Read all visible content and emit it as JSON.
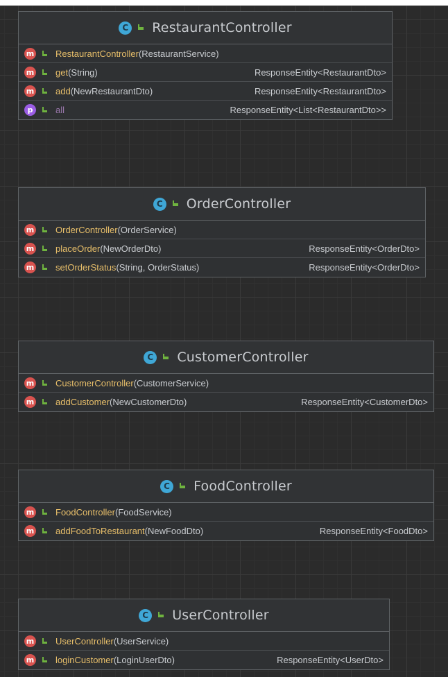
{
  "classes": [
    {
      "name": "RestaurantController",
      "icon": "class-icon",
      "members": [
        {
          "icon": "method-icon",
          "name": "RestaurantController",
          "params": "(RestaurantService)",
          "returns": ""
        },
        {
          "icon": "method-icon",
          "name": "get",
          "params": "(String)",
          "returns": "ResponseEntity<RestaurantDto>"
        },
        {
          "icon": "method-icon",
          "name": "add",
          "params": "(NewRestaurantDto)",
          "returns": "ResponseEntity<RestaurantDto>"
        },
        {
          "icon": "property-icon",
          "name": "all",
          "params": "",
          "returns": "ResponseEntity<List<RestaurantDto>>"
        }
      ]
    },
    {
      "name": "OrderController",
      "icon": "class-icon",
      "members": [
        {
          "icon": "method-icon",
          "name": "OrderController",
          "params": "(OrderService)",
          "returns": ""
        },
        {
          "icon": "method-icon",
          "name": "placeOrder",
          "params": "(NewOrderDto)",
          "returns": "ResponseEntity<OrderDto>"
        },
        {
          "icon": "method-icon",
          "name": "setOrderStatus",
          "params": "(String, OrderStatus)",
          "returns": "ResponseEntity<OrderDto>"
        }
      ]
    },
    {
      "name": "CustomerController",
      "icon": "class-icon",
      "members": [
        {
          "icon": "method-icon",
          "name": "CustomerController",
          "params": "(CustomerService)",
          "returns": ""
        },
        {
          "icon": "method-icon",
          "name": "addCustomer",
          "params": "(NewCustomerDto)",
          "returns": "ResponseEntity<CustomerDto>"
        }
      ]
    },
    {
      "name": "FoodController",
      "icon": "class-icon",
      "members": [
        {
          "icon": "method-icon",
          "name": "FoodController",
          "params": "(FoodService)",
          "returns": ""
        },
        {
          "icon": "method-icon",
          "name": "addFoodToRestaurant",
          "params": "(NewFoodDto)",
          "returns": "ResponseEntity<FoodDto>"
        }
      ]
    },
    {
      "name": "UserController",
      "icon": "class-icon",
      "members": [
        {
          "icon": "method-icon",
          "name": "UserController",
          "params": "(UserService)",
          "returns": ""
        },
        {
          "icon": "method-icon",
          "name": "loginCustomer",
          "params": "(LoginUserDto)",
          "returns": "ResponseEntity<UserDto>"
        }
      ]
    }
  ],
  "colors": {
    "background": "#2b2b2b",
    "method_name": "#e8bf6a",
    "property_name": "#9876aa",
    "class_icon": "#3fa7d6",
    "method_icon": "#d9534f",
    "property_icon": "#9b5de5",
    "visibility_public": "#6fb33f"
  }
}
